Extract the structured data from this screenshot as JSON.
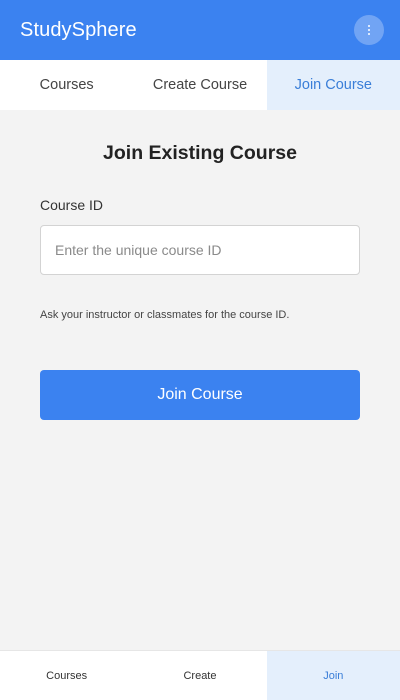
{
  "header": {
    "title": "StudySphere",
    "menu_icon": "more-vertical-icon",
    "background_color": "#3b82f0"
  },
  "top_tabs": [
    {
      "label": "Courses",
      "active": false
    },
    {
      "label": "Create Course",
      "active": false
    },
    {
      "label": "Join Course",
      "active": true
    }
  ],
  "join_form": {
    "title": "Join Existing Course",
    "field_label": "Course ID",
    "input_value": "",
    "input_placeholder": "Enter the unique course ID",
    "help_text": "Ask your instructor or classmates for the course ID.",
    "submit_label": "Join Course"
  },
  "bottom_nav": [
    {
      "label": "Courses",
      "active": false
    },
    {
      "label": "Create",
      "active": false
    },
    {
      "label": "Join",
      "active": true
    }
  ],
  "colors": {
    "accent": "#3b82f0",
    "active_tab_bg": "#e4effc",
    "active_tab_text": "#3a7ed8",
    "page_bg": "#f3f3f3"
  }
}
